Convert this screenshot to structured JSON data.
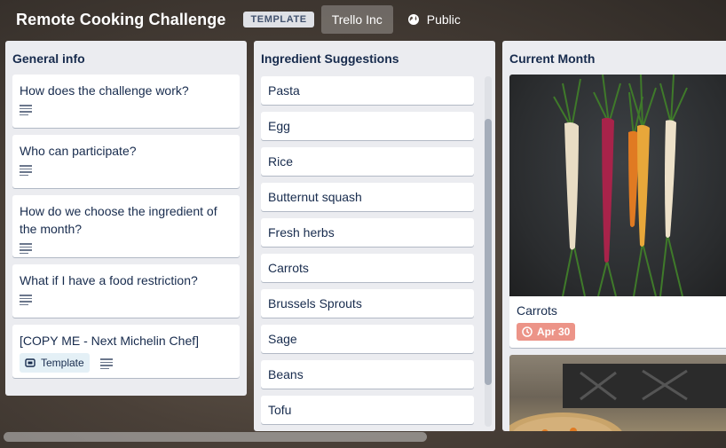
{
  "header": {
    "title": "Remote Cooking Challenge",
    "badge": "TEMPLATE",
    "team": "Trello Inc",
    "visibility": "Public"
  },
  "lists": [
    {
      "title": "General info",
      "cards": [
        {
          "title": "How does the challenge work?"
        },
        {
          "title": "Who can participate?"
        },
        {
          "title": "How do we choose the ingredient of the month?"
        },
        {
          "title": "What if I have a food restriction?"
        },
        {
          "title": "[COPY ME - Next Michelin Chef]",
          "tag": "Template"
        }
      ]
    },
    {
      "title": "Ingredient Suggestions",
      "cards": [
        "Pasta",
        "Egg",
        "Rice",
        "Butternut squash",
        "Fresh herbs",
        "Carrots",
        "Brussels Sprouts",
        "Sage",
        "Beans",
        "Tofu"
      ]
    },
    {
      "title": "Current Month",
      "cards": [
        {
          "title": "Carrots",
          "due": "Apr 30"
        }
      ]
    }
  ],
  "colors": {
    "due_badge": "#ec9488",
    "list_bg": "#ebecf0",
    "template_tag_bg": "#e4f0f6"
  }
}
